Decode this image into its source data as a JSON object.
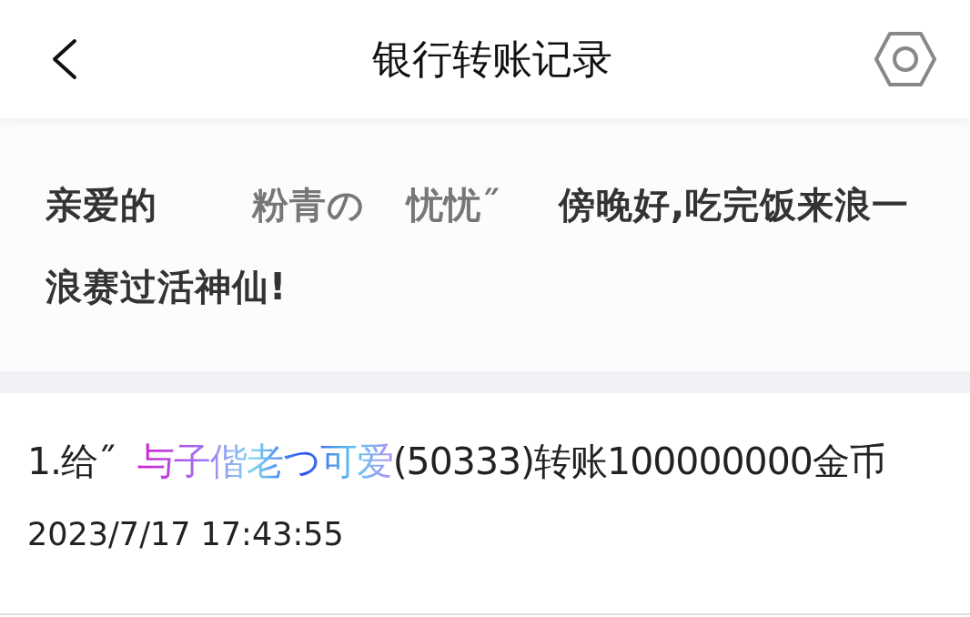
{
  "header": {
    "title": "银行转账记录"
  },
  "greeting": {
    "prefix": "亲爱的",
    "name_parts": [
      "粉青の",
      "忧忧˝"
    ],
    "message": "傍晚好,吃完饭来浪一浪赛过活神仙!"
  },
  "records": [
    {
      "prefix": "1.给˝",
      "recipient": "与子偕老つ可爱",
      "detail": "(50333)转账100000000金币",
      "time": "2023/7/17 17:43:55"
    }
  ]
}
